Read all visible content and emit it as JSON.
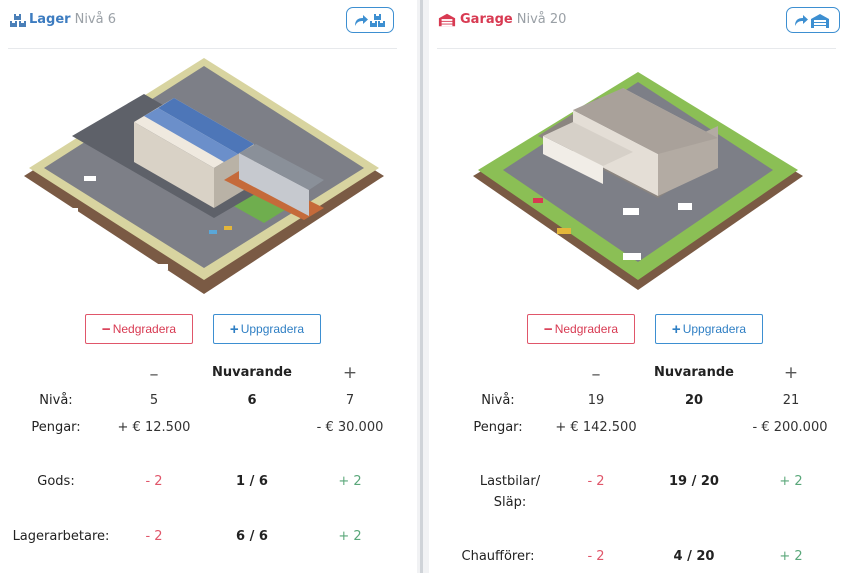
{
  "colors": {
    "accent_blue": "#3d8fd1",
    "danger_red": "#e0566a",
    "success_green": "#5aa77a",
    "garage_red": "#d83a52"
  },
  "left": {
    "title": "Lager",
    "level": "Nivå 6",
    "title_icon": "warehouse-icon",
    "action_icon": "share-warehouse-icon",
    "downgrade_label": "Nedgradera",
    "upgrade_label": "Uppgradera",
    "col_minus": "–",
    "col_current": "Nuvarande",
    "col_plus": "+",
    "rows": [
      {
        "label": "Nivå:",
        "minus": "5",
        "current": "6",
        "plus": "7"
      },
      {
        "label": "Pengar:",
        "minus": "+ € 12.500",
        "current": "",
        "plus": "- € 30.000"
      },
      {
        "label": "Gods:",
        "minus": "- 2",
        "current": "1 / 6",
        "plus": "+ 2"
      },
      {
        "label": "Lagerarbetare:",
        "minus": "- 2",
        "current": "6 / 6",
        "plus": "+ 2"
      }
    ]
  },
  "right": {
    "title": "Garage",
    "level": "Nivå 20",
    "title_icon": "garage-icon",
    "action_icon": "share-garage-icon",
    "downgrade_label": "Nedgradera",
    "upgrade_label": "Uppgradera",
    "col_minus": "–",
    "col_current": "Nuvarande",
    "col_plus": "+",
    "rows": [
      {
        "label": "Nivå:",
        "minus": "19",
        "current": "20",
        "plus": "21"
      },
      {
        "label": "Pengar:",
        "minus": "+ € 142.500",
        "current": "",
        "plus": "- € 200.000"
      },
      {
        "label_line1": "Lastbilar/",
        "label_line2": "Släp:",
        "minus": "- 2",
        "current": "19 / 20",
        "plus": "+ 2"
      },
      {
        "label": "Chaufförer:",
        "minus": "- 2",
        "current": "4 / 20",
        "plus": "+ 2"
      }
    ]
  }
}
